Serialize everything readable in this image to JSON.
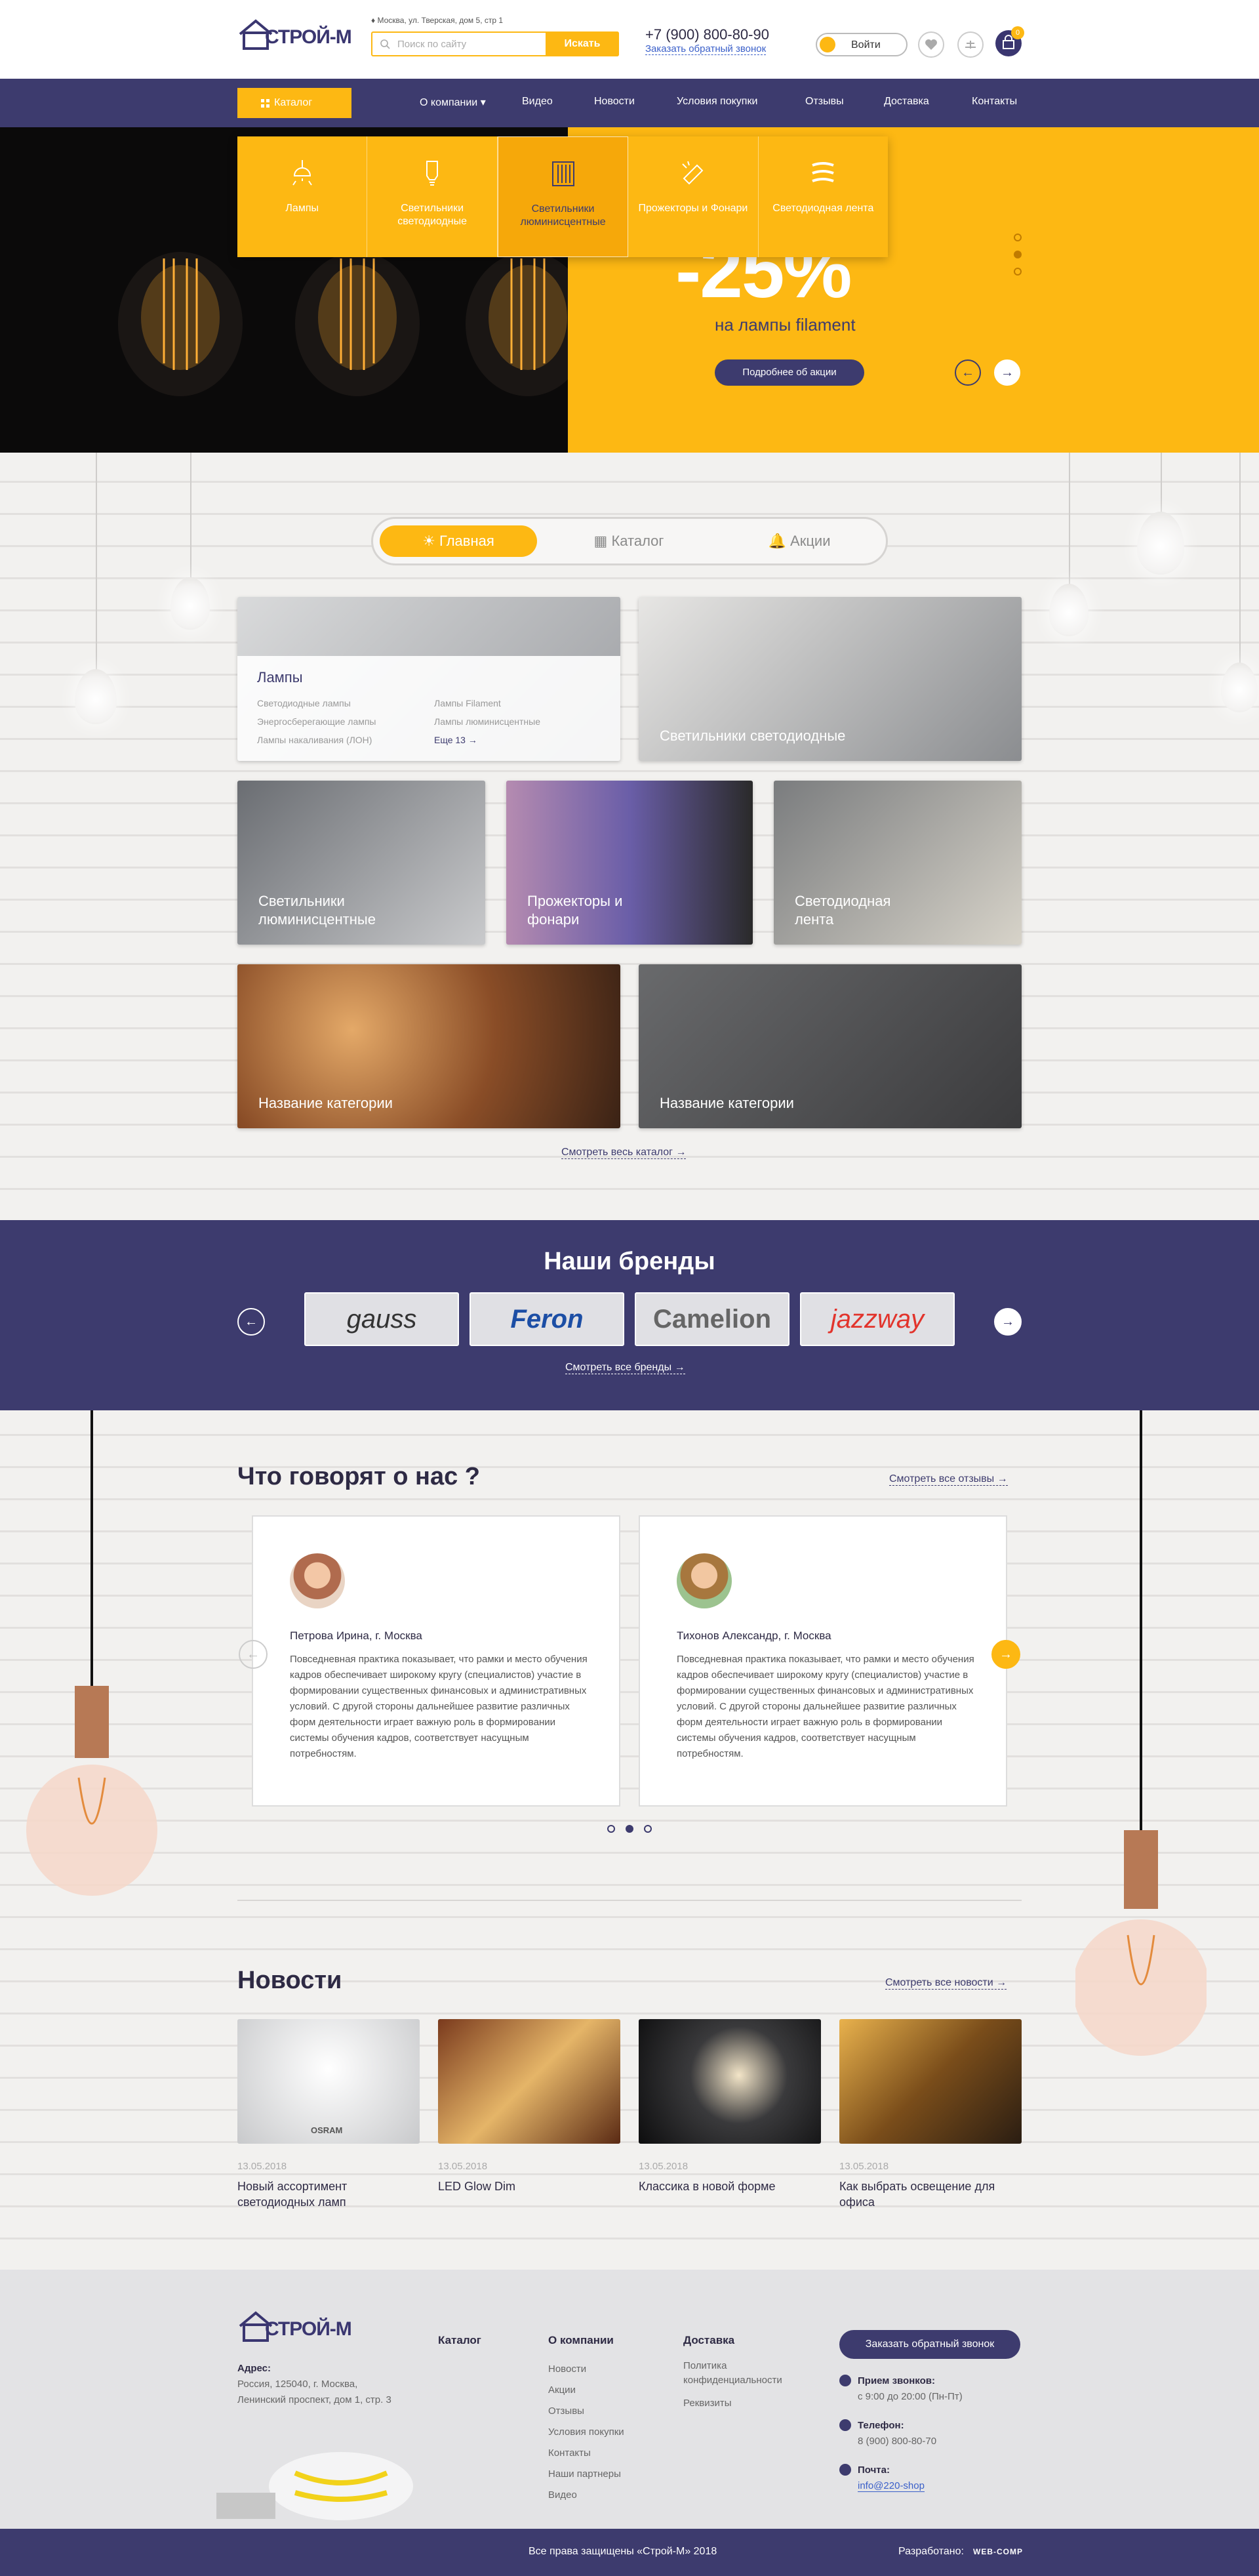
{
  "header": {
    "logo_text": "СТРОЙ-М",
    "address": "Москва, ул. Тверская, дом 5, стр 1",
    "search_placeholder": "Поиск по сайту",
    "search_button": "Искать",
    "phone": "+7 (900) 800-80-90",
    "callback_link": "Заказать обратный звонок",
    "login_label": "Войти",
    "cart_count": "0"
  },
  "nav": {
    "catalog_label": "Каталог",
    "items": [
      "О компании",
      "Видео",
      "Новости",
      "Условия покупки",
      "Отзывы",
      "Доставка",
      "Контакты"
    ]
  },
  "catalog_dropdown": {
    "items": [
      {
        "label": "Лампы",
        "icon": "ceiling-lamp-icon"
      },
      {
        "label": "Светильники светодиодные",
        "icon": "led-bulb-icon"
      },
      {
        "label": "Светильники люминисцентные",
        "icon": "fluorescent-tube-icon"
      },
      {
        "label": "Прожекторы и Фонари",
        "icon": "spotlight-icon"
      },
      {
        "label": "Светодиодная лента",
        "icon": "led-strip-icon"
      }
    ]
  },
  "hero": {
    "discount": "-25%",
    "subtitle": "на лампы filament",
    "button": "Подробнее об акции",
    "prev": "←",
    "next": "→"
  },
  "tabs": [
    "Главная",
    "Каталог",
    "Акции"
  ],
  "categories": {
    "lamps": {
      "title": "Лампы",
      "links_left": [
        "Светодиодные лампы",
        "Энергосберегающие лампы",
        "Лампы накаливания (ЛОН)"
      ],
      "links_right": [
        "Лампы Filament",
        "Лампы люминисцентные"
      ],
      "more": "Еще 13"
    },
    "tiles": [
      "Светильники светодиодные",
      "Светильники люминисцентные",
      "Прожекторы и фонари",
      "Светодиодная лента",
      "Название категории",
      "Название категории"
    ],
    "all_link": "Смотреть весь каталог"
  },
  "brands": {
    "title": "Наши бренды",
    "items": [
      "gauss",
      "Feron",
      "Camelion",
      "jazzway"
    ],
    "all_link": "Смотреть все бренды"
  },
  "reviews": {
    "title": "Что говорят о нас ?",
    "all_link": "Смотреть все отзывы",
    "items": [
      {
        "name": "Петрова Ирина, г. Москва",
        "text": "Повседневная практика показывает, что рамки и место обучения кадров обеспечивает широкому кругу (специалистов) участие в формировании существенных финансовых и административных условий. С другой стороны дальнейшее развитие различных форм деятельности играет важную роль в формировании системы обучения кадров, соответствует насущным потребностям."
      },
      {
        "name": "Тихонов Александр, г. Москва",
        "text": "Повседневная практика показывает, что рамки и место обучения кадров обеспечивает широкому кругу (специалистов) участие в формировании существенных финансовых и административных условий. С другой стороны дальнейшее развитие различных форм деятельности играет важную роль в формировании системы обучения кадров, соответствует насущным потребностям."
      }
    ]
  },
  "news": {
    "title": "Новости",
    "all_link": "Смотреть все новости",
    "items": [
      {
        "date": "13.05.2018",
        "title": "Новый ассортимент светодиодных ламп",
        "brand": "OSRAM"
      },
      {
        "date": "13.05.2018",
        "title": "LED Glow Dim"
      },
      {
        "date": "13.05.2018",
        "title": "Классика в новой форме"
      },
      {
        "date": "13.05.2018",
        "title": "Как выбрать освещение для офиса"
      }
    ]
  },
  "footer": {
    "address_label": "Адрес:",
    "address": "Россия, 125040, г. Москва, Ленинский проспект, дом 1, стр. 3",
    "col_catalog": "Каталог",
    "col_company": "О компании",
    "company_links": [
      "Новости",
      "Акции",
      "Отзывы",
      "Условия покупки",
      "Контакты",
      "Наши партнеры",
      "Видео"
    ],
    "col_delivery": "Доставка",
    "delivery_links": [
      "Политика конфиденциальности",
      "Реквизиты"
    ],
    "callback_button": "Заказать обратный звонок",
    "hours_label": "Прием звонков:",
    "hours": "с 9:00 до 20:00 (Пн-Пт)",
    "phone_label": "Телефон:",
    "phone": "8 (900) 800-80-70",
    "mail_label": "Почта:",
    "mail": "info@220-shop",
    "copyright": "Все права защищены «Строй-М» 2018",
    "developed_label": "Разработано:",
    "developer": "WEB-COMP"
  },
  "colors": {
    "accent": "#fdb813",
    "brand": "#3d3b6e"
  }
}
